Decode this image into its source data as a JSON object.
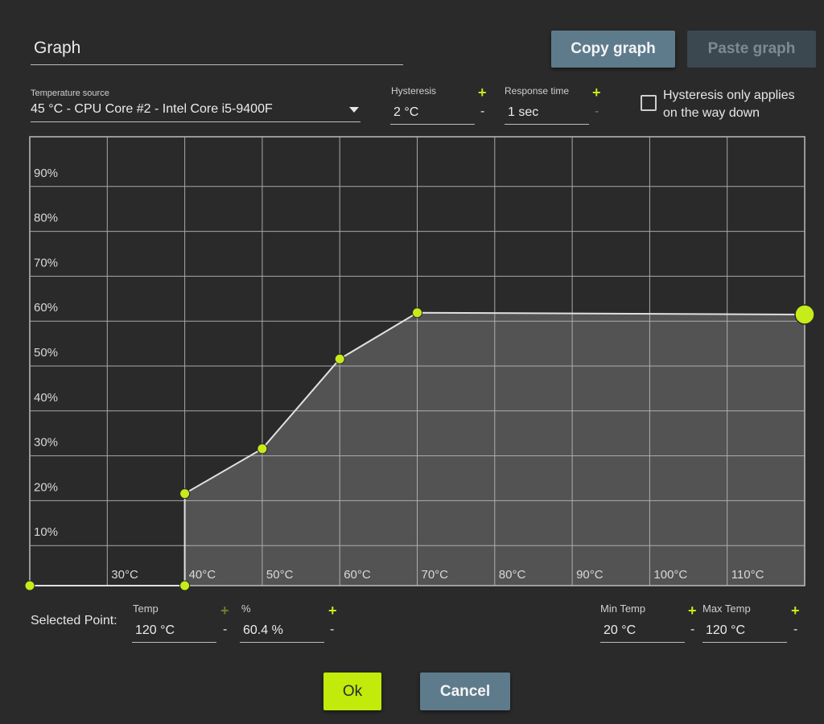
{
  "graph_name": "Graph",
  "buttons": {
    "copy": "Copy graph",
    "paste": "Paste graph",
    "ok": "Ok",
    "cancel": "Cancel"
  },
  "temperature_source": {
    "label": "Temperature source",
    "value": "45 °C - CPU Core #2 - Intel Core i5-9400F"
  },
  "hysteresis": {
    "label": "Hysteresis",
    "value": "2 °C"
  },
  "response_time": {
    "label": "Response time",
    "value": "1 sec"
  },
  "hysteresis_down": {
    "label_line1": "Hysteresis only applies",
    "label_line2": "on the way down",
    "checked": false
  },
  "selected_point": {
    "label": "Selected Point:",
    "temp_label": "Temp",
    "temp_value": "120 °C",
    "pct_label": "%",
    "pct_value": "60.4 %"
  },
  "min_temp": {
    "label": "Min Temp",
    "value": "20 °C"
  },
  "max_temp": {
    "label": "Max Temp",
    "value": "120 °C"
  },
  "symbols": {
    "plus": "+",
    "minus": "-"
  },
  "colors": {
    "accent": "#c6ec1a",
    "button": "#5e7b8c",
    "background": "#2a2a2a"
  },
  "chart_data": {
    "type": "area",
    "xlim": [
      20,
      120
    ],
    "ylim": [
      0,
      100
    ],
    "x_tick_labels": [
      "30°C",
      "40°C",
      "50°C",
      "60°C",
      "70°C",
      "80°C",
      "90°C",
      "100°C",
      "110°C"
    ],
    "x_ticks": [
      30,
      40,
      50,
      60,
      70,
      80,
      90,
      100,
      110
    ],
    "y_tick_labels": [
      "10%",
      "20%",
      "30%",
      "40%",
      "50%",
      "60%",
      "70%",
      "80%",
      "90%"
    ],
    "y_ticks": [
      10,
      20,
      30,
      40,
      50,
      60,
      70,
      80,
      90
    ],
    "grid": true,
    "points": [
      {
        "x": 20,
        "y": 0
      },
      {
        "x": 40,
        "y": 0
      },
      {
        "x": 40,
        "y": 20.5
      },
      {
        "x": 50,
        "y": 30.5
      },
      {
        "x": 60,
        "y": 50.5
      },
      {
        "x": 70,
        "y": 60.8
      },
      {
        "x": 120,
        "y": 60.4
      }
    ],
    "selected_index": 6
  }
}
